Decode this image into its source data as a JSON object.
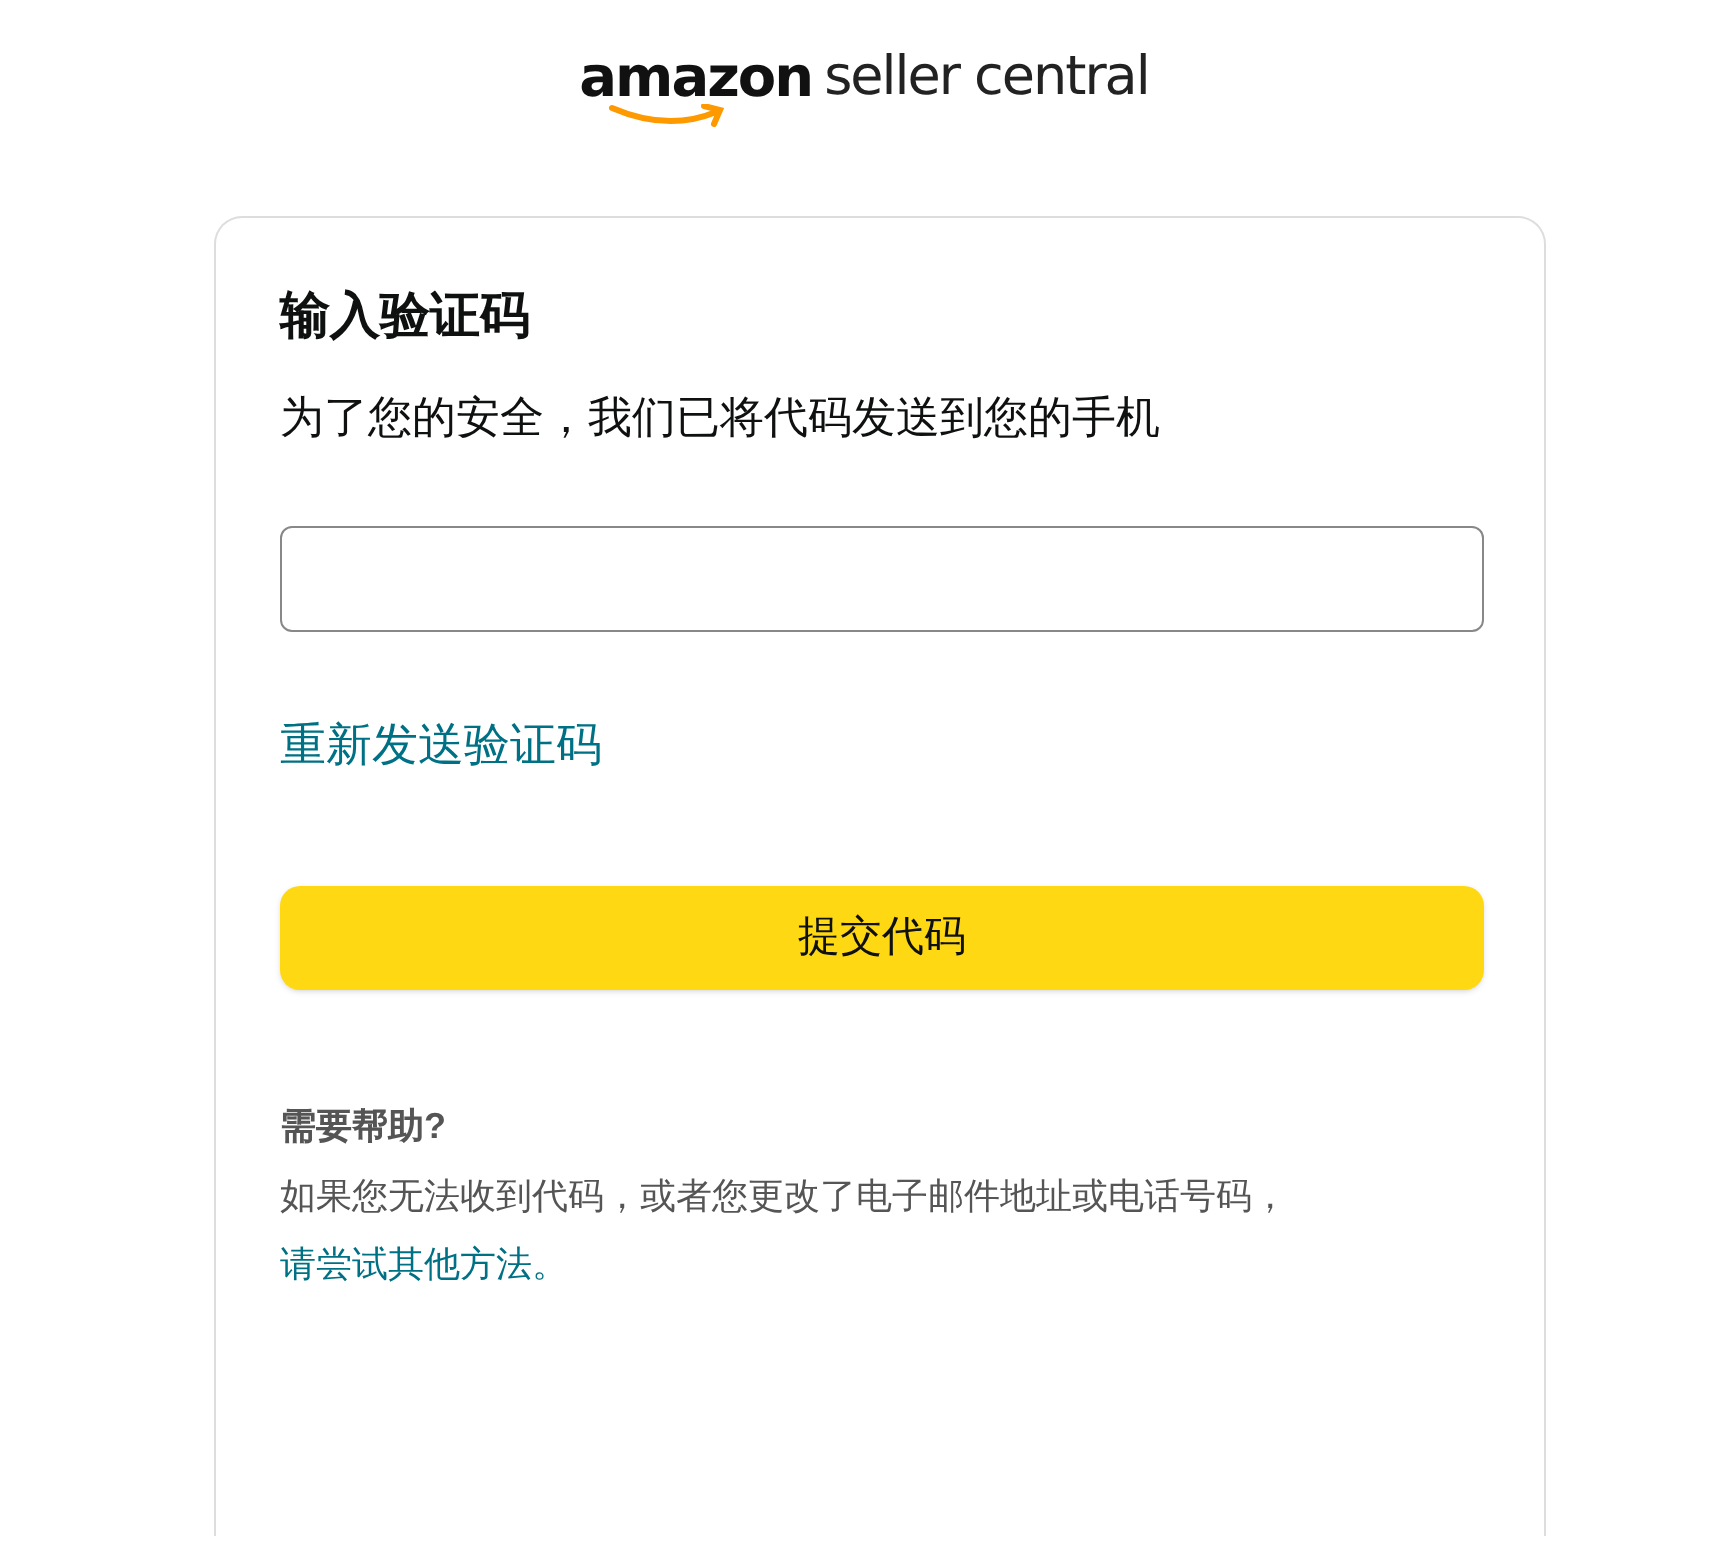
{
  "logo": {
    "brand": "amazon",
    "product": "seller central"
  },
  "card": {
    "title": "输入验证码",
    "message": "为了您的安全，我们已将代码发送到您的手机",
    "resend_link": "重新发送验证码",
    "submit_button": "提交代码",
    "help": {
      "title": "需要帮助?",
      "text": "如果您无法收到代码，或者您更改了电子邮件地址或电话号码，",
      "link": "请尝试其他方法。"
    }
  }
}
